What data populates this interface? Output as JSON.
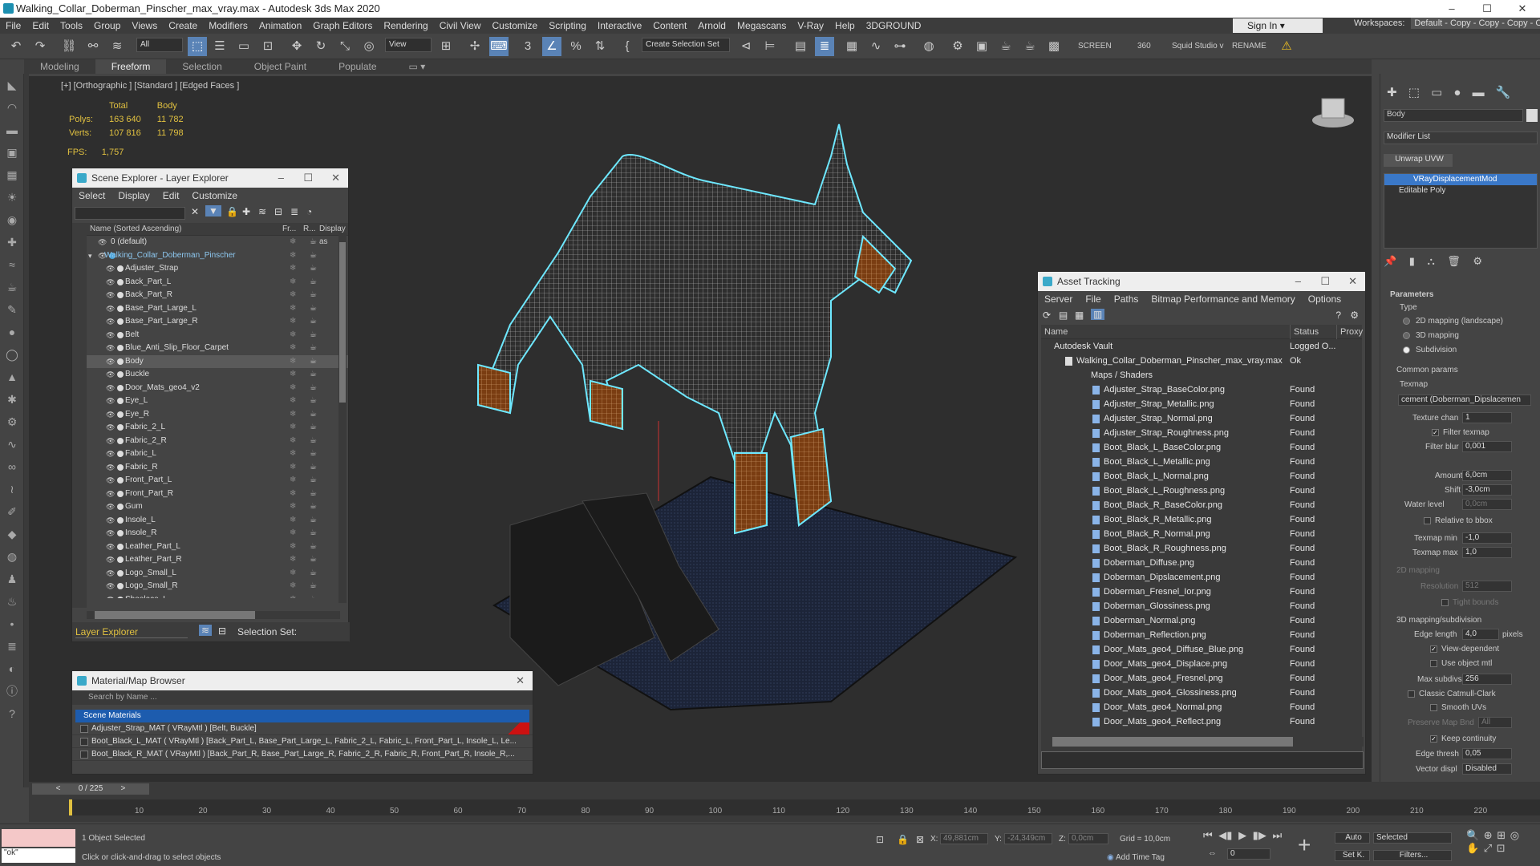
{
  "app": {
    "title": "Walking_Collar_Doberman_Pinscher_max_vray.max - Autodesk 3ds Max 2020",
    "min": "–",
    "max": "☐",
    "close": "✕"
  },
  "menu": [
    "File",
    "Edit",
    "Tools",
    "Group",
    "Views",
    "Create",
    "Modifiers",
    "Animation",
    "Graph Editors",
    "Rendering",
    "Civil View",
    "Customize",
    "Scripting",
    "Interactive",
    "Content",
    "Arnold",
    "Megascans",
    "V-Ray",
    "Help",
    "3DGROUND"
  ],
  "signin": "Sign In",
  "workspaces": {
    "label": "Workspaces:",
    "value": "Default - Copy - Copy - Copy - Copy"
  },
  "toolbar": {
    "filter": "All",
    "view": "View",
    "selset": "Create Selection Set",
    "screen": "SCREEN",
    "angle": "360",
    "squid": "Squid Studio v",
    "rename": "RENAME"
  },
  "ribbon": [
    "Modeling",
    "Freeform",
    "Selection",
    "Object Paint",
    "Populate"
  ],
  "viewport": {
    "label": "[+] [Orthographic ] [Standard ] [Edged Faces ]",
    "stats": {
      "h_total": "Total",
      "h_body": "Body",
      "polys_label": "Polys:",
      "polys_total": "163 640",
      "polys_body": "11 782",
      "verts_label": "Verts:",
      "verts_total": "107 816",
      "verts_body": "11 798"
    },
    "fps_label": "FPS:",
    "fps": "1,757"
  },
  "scene_explorer": {
    "title": "Scene Explorer - Layer Explorer",
    "menu": [
      "Select",
      "Display",
      "Edit",
      "Customize"
    ],
    "col_name": "Name (Sorted Ascending)",
    "col_fr": "Fr...",
    "col_r": "R...",
    "col_disp": "Display as",
    "rows": [
      "0 (default)",
      "Walking_Collar_Doberman_Pinscher",
      "Adjuster_Strap",
      "Back_Part_L",
      "Back_Part_R",
      "Base_Part_Large_L",
      "Base_Part_Large_R",
      "Belt",
      "Blue_Anti_Slip_Floor_Carpet",
      "Body",
      "Buckle",
      "Door_Mats_geo4_v2",
      "Eye_L",
      "Eye_R",
      "Fabric_2_L",
      "Fabric_2_R",
      "Fabric_L",
      "Fabric_R",
      "Front_Part_L",
      "Front_Part_R",
      "Gum",
      "Insole_L",
      "Insole_R",
      "Leather_Part_L",
      "Leather_Part_R",
      "Logo_Small_L",
      "Logo_Small_R",
      "Shoelace_L"
    ],
    "footer": "Layer Explorer",
    "selset": "Selection Set:"
  },
  "asset_tracking": {
    "title": "Asset Tracking",
    "menu": [
      "Server",
      "File",
      "Paths",
      "Bitmap Performance and Memory",
      "Options"
    ],
    "col_name": "Name",
    "col_status": "Status",
    "col_proxy": "Proxy",
    "vault": "Autodesk Vault",
    "vault_status": "Logged O...",
    "file": "Walking_Collar_Doberman_Pinscher_max_vray.max",
    "file_status": "Ok",
    "maps": "Maps / Shaders",
    "found": "Found",
    "items": [
      "Adjuster_Strap_BaseColor.png",
      "Adjuster_Strap_Metallic.png",
      "Adjuster_Strap_Normal.png",
      "Adjuster_Strap_Roughness.png",
      "Boot_Black_L_BaseColor.png",
      "Boot_Black_L_Metallic.png",
      "Boot_Black_L_Normal.png",
      "Boot_Black_L_Roughness.png",
      "Boot_Black_R_BaseColor.png",
      "Boot_Black_R_Metallic.png",
      "Boot_Black_R_Normal.png",
      "Boot_Black_R_Roughness.png",
      "Doberman_Diffuse.png",
      "Doberman_Dipslacement.png",
      "Doberman_Fresnel_Ior.png",
      "Doberman_Glossiness.png",
      "Doberman_Normal.png",
      "Doberman_Reflection.png",
      "Door_Mats_geo4_Diffuse_Blue.png",
      "Door_Mats_geo4_Displace.png",
      "Door_Mats_geo4_Fresnel.png",
      "Door_Mats_geo4_Glossiness.png",
      "Door_Mats_geo4_Normal.png",
      "Door_Mats_geo4_Reflect.png"
    ]
  },
  "material_browser": {
    "title": "Material/Map Browser",
    "search": "Search by Name ...",
    "section": "Scene Materials",
    "rows": [
      "Adjuster_Strap_MAT  ( VRayMtl ) [Belt, Buckle]",
      "Boot_Black_L_MAT  ( VRayMtl ) [Back_Part_L, Base_Part_Large_L, Fabric_2_L, Fabric_L, Front_Part_L, Insole_L, Le...",
      "Boot_Black_R_MAT  ( VRayMtl ) [Back_Part_R, Base_Part_Large_R, Fabric_2_R, Fabric_R, Front_Part_R, Insole_R,..."
    ]
  },
  "command_panel": {
    "obj_name": "Body",
    "modlist": "Modifier List",
    "unwrap": "Unwrap UVW",
    "stack": [
      "VRayDisplacementMod",
      "Editable Poly"
    ],
    "params": "Parameters",
    "type": "Type",
    "t1": "2D mapping (landscape)",
    "t2": "3D mapping",
    "t3": "Subdivision",
    "common": "Common params",
    "texmap": "Texmap",
    "texmap_val": "cement (Doberman_Dipslacemen",
    "texchan_l": "Texture chan",
    "texchan": "1",
    "filter": "Filter texmap",
    "fblur_l": "Filter blur",
    "fblur": "0,001",
    "amount_l": "Amount",
    "amount": "6,0cm",
    "shift_l": "Shift",
    "shift": "-3,0cm",
    "water_l": "Water level",
    "water": "0,0cm",
    "relbbox": "Relative to bbox",
    "tmin_l": "Texmap min",
    "tmin": "-1,0",
    "tmax_l": "Texmap max",
    "tmax": "1,0",
    "map2d": "2D mapping",
    "res_l": "Resolution",
    "res": "512",
    "tight": "Tight bounds",
    "map3d": "3D mapping/subdivision",
    "edge_l": "Edge length",
    "edge": "4,0",
    "pixels": "pixels",
    "viewdep": "View-dependent",
    "useobj": "Use object mtl",
    "maxsub_l": "Max subdivs",
    "maxsub": "256",
    "classic": "Classic Catmull-Clark",
    "smooth": "Smooth UVs",
    "pmb_l": "Preserve Map Bnd",
    "pmb": "All",
    "keepc": "Keep continuity",
    "ethr_l": "Edge thresh",
    "ethr": "0,05",
    "vdisp_l": "Vector displ",
    "vdisp": "Disabled"
  },
  "timeline": {
    "frame": "0 / 225",
    "ticks": [
      "10",
      "20",
      "30",
      "40",
      "50",
      "60",
      "70",
      "80",
      "90",
      "100",
      "110",
      "120",
      "130",
      "140",
      "150",
      "160",
      "170",
      "180",
      "190",
      "200",
      "210",
      "220"
    ]
  },
  "status": {
    "script": "\"ok\"",
    "selected": "1 Object Selected",
    "hint": "Click or click-and-drag to select objects",
    "x_l": "X:",
    "x": "49,881cm",
    "y_l": "Y:",
    "y": "-24,349cm",
    "z_l": "Z:",
    "z": "0,0cm",
    "grid": "Grid = 10,0cm",
    "addtime": "Add Time Tag",
    "auto": "Auto",
    "selmode": "Selected",
    "setk": "Set K.",
    "filters": "Filters...",
    "frame": "0"
  }
}
